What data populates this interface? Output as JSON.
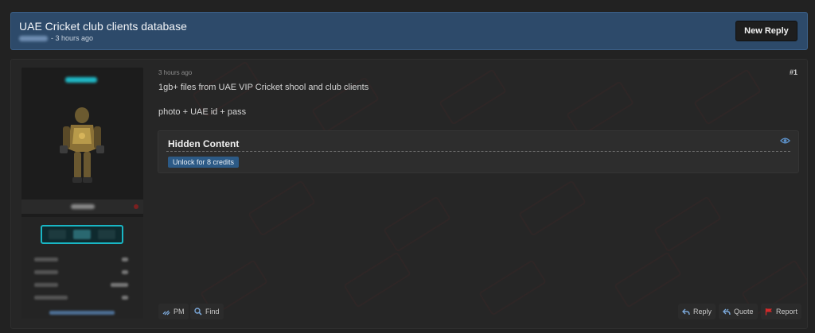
{
  "thread": {
    "title": "UAE Cricket club clients database",
    "meta_suffix": "- 3 hours ago",
    "new_reply_label": "New Reply"
  },
  "post": {
    "date": "3 hours ago",
    "number": "#1",
    "lines": [
      "1gb+ files from UAE VIP Cricket shool and club clients",
      "photo + UAE id + pass"
    ],
    "hidden_content": {
      "title": "Hidden Content",
      "unlock_label": "Unlock for 8 credits"
    },
    "actions_left": [
      {
        "label": "PM",
        "icon": "pm-icon"
      },
      {
        "label": "Find",
        "icon": "search-icon"
      }
    ],
    "actions_right": [
      {
        "label": "Reply",
        "icon": "reply-icon"
      },
      {
        "label": "Quote",
        "icon": "quote-icon"
      },
      {
        "label": "Report",
        "icon": "flag-icon"
      }
    ]
  },
  "colors": {
    "header_bg": "#2d4a6a",
    "accent_cyan": "#19b6c4",
    "unlock_bg": "#2c5a86",
    "report_red": "#d42a2a"
  }
}
